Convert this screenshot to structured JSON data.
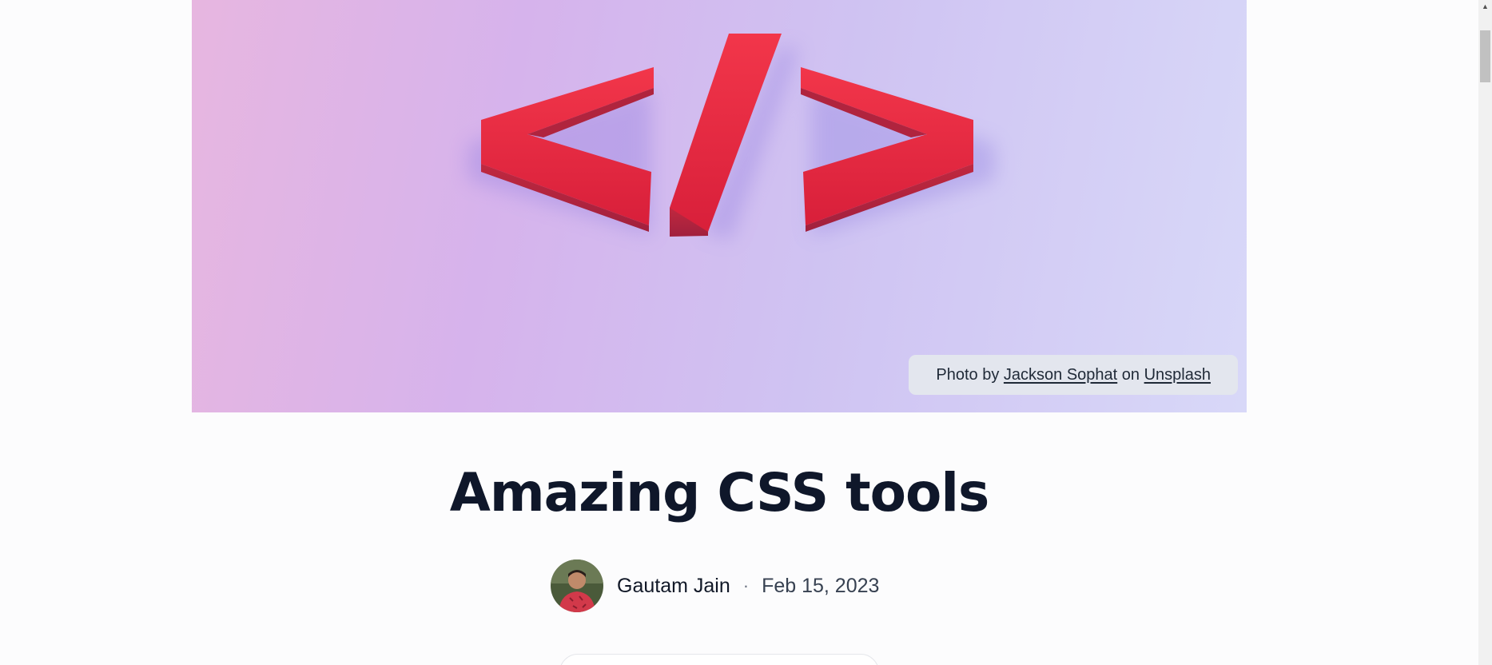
{
  "hero": {
    "image_name": "code-brackets-icon",
    "credit": {
      "prefix": "Photo by",
      "photographer": "Jackson Sophat",
      "middle": "on",
      "source": "Unsplash"
    }
  },
  "article": {
    "title": "Amazing CSS tools",
    "author": "Gautam Jain",
    "separator": "·",
    "date": "Feb 15, 2023"
  },
  "colors": {
    "accent": "#ee2a3f",
    "title": "#0f172a",
    "credit_bg": "#e3e6ee"
  }
}
